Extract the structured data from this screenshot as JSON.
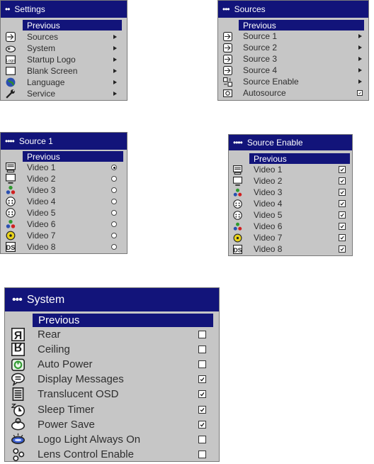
{
  "settings": {
    "title": "Settings",
    "title_dots": "••",
    "previous": "Previous",
    "items": [
      {
        "label": "Sources",
        "icon": "sources-icon"
      },
      {
        "label": "System",
        "icon": "system-icon"
      },
      {
        "label": "Startup Logo",
        "icon": "startup-logo-icon"
      },
      {
        "label": "Blank Screen",
        "icon": "blank-screen-icon"
      },
      {
        "label": "Language",
        "icon": "language-globe-icon"
      },
      {
        "label": "Service",
        "icon": "service-wrench-icon"
      }
    ]
  },
  "sources": {
    "title": "Sources",
    "title_dots": "•••",
    "previous": "Previous",
    "items": [
      {
        "label": "Source 1",
        "icon": "source-input-icon"
      },
      {
        "label": "Source 2",
        "icon": "source-input-icon"
      },
      {
        "label": "Source 3",
        "icon": "source-input-icon"
      },
      {
        "label": "Source 4",
        "icon": "source-input-icon"
      },
      {
        "label": "Source Enable",
        "icon": "source-enable-icon"
      },
      {
        "label": "Autosource",
        "icon": "autosource-icon",
        "checked": true
      }
    ]
  },
  "source1": {
    "title": "Source 1",
    "title_dots": "••••",
    "previous": "Previous",
    "items": [
      {
        "label": "Video 1",
        "icon": "computer-icon",
        "selected": true
      },
      {
        "label": "Video 2",
        "icon": "monitor-icon",
        "selected": false
      },
      {
        "label": "Video 3",
        "icon": "component-video-icon",
        "selected": false
      },
      {
        "label": "Video 4",
        "icon": "svideo-icon",
        "selected": false
      },
      {
        "label": "Video 5",
        "icon": "svideo-icon",
        "selected": false
      },
      {
        "label": "Video 6",
        "icon": "component-video-icon",
        "selected": false
      },
      {
        "label": "Video 7",
        "icon": "composite-video-icon",
        "selected": false
      },
      {
        "label": "Video 8",
        "icon": "ds-icon",
        "selected": false
      }
    ]
  },
  "source_enable": {
    "title": "Source Enable",
    "title_dots": "••••",
    "previous": "Previous",
    "items": [
      {
        "label": "Video 1",
        "icon": "computer-icon",
        "checked": true
      },
      {
        "label": "Video 2",
        "icon": "monitor-icon",
        "checked": true
      },
      {
        "label": "Video 3",
        "icon": "component-video-icon",
        "checked": true
      },
      {
        "label": "Video 4",
        "icon": "svideo-icon",
        "checked": true
      },
      {
        "label": "Video 5",
        "icon": "svideo-icon",
        "checked": true
      },
      {
        "label": "Video 6",
        "icon": "component-video-icon",
        "checked": true
      },
      {
        "label": "Video 7",
        "icon": "composite-video-icon",
        "checked": true
      },
      {
        "label": "Video 8",
        "icon": "ds-icon",
        "checked": true
      }
    ]
  },
  "system": {
    "title": "System",
    "title_dots": "•••",
    "previous": "Previous",
    "items": [
      {
        "label": "Rear",
        "icon": "rear-projection-icon",
        "checked": false
      },
      {
        "label": "Ceiling",
        "icon": "ceiling-mount-icon",
        "checked": false
      },
      {
        "label": "Auto Power",
        "icon": "auto-power-icon",
        "checked": false
      },
      {
        "label": "Display Messages",
        "icon": "display-messages-icon",
        "checked": true
      },
      {
        "label": "Translucent OSD",
        "icon": "translucent-osd-icon",
        "checked": true
      },
      {
        "label": "Sleep Timer",
        "icon": "sleep-timer-icon",
        "checked": true
      },
      {
        "label": "Power Save",
        "icon": "power-save-icon",
        "checked": true
      },
      {
        "label": "Logo Light Always On",
        "icon": "logo-light-icon",
        "checked": false
      },
      {
        "label": "Lens Control Enable",
        "icon": "lens-control-icon",
        "checked": false
      }
    ]
  },
  "colors": {
    "titlebar": "#12147a",
    "panel": "#c6c6c6",
    "text": "#2e2e2e"
  }
}
